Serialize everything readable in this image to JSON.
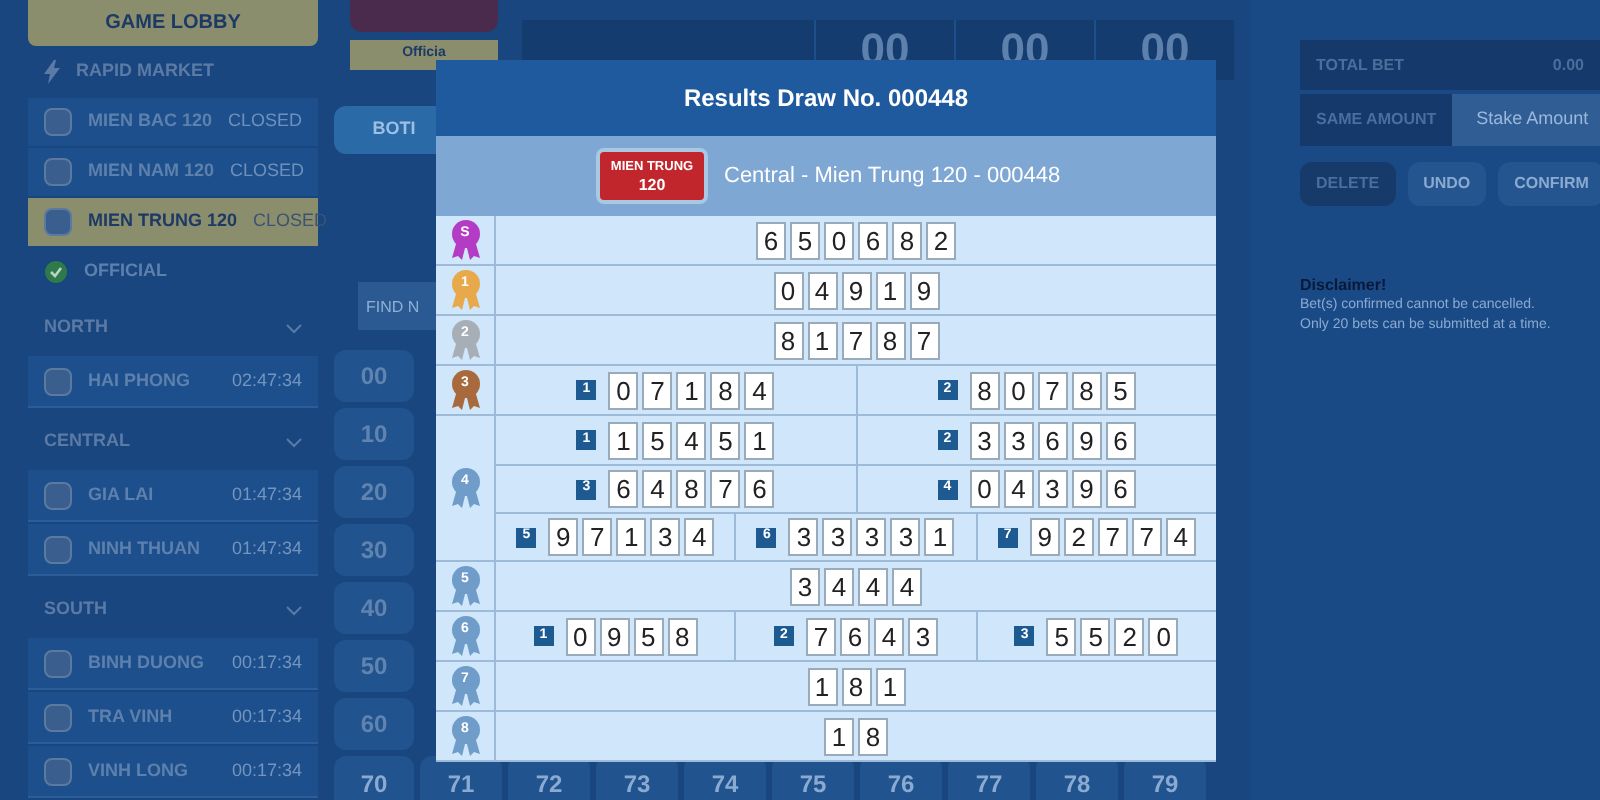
{
  "sidebar": {
    "lobby_button": "GAME LOBBY",
    "rapid_market": "RAPID MARKET",
    "markets": [
      {
        "name": "MIEN BAC 120",
        "status": "CLOSED",
        "selected": false
      },
      {
        "name": "MIEN NAM 120",
        "status": "CLOSED",
        "selected": false
      },
      {
        "name": "MIEN TRUNG 120",
        "status": "CLOSED",
        "selected": true
      }
    ],
    "official": "OFFICIAL",
    "regions": [
      {
        "name": "NORTH",
        "expanded": true,
        "items": [
          {
            "name": "HAI PHONG",
            "time": "02:47:34"
          }
        ]
      },
      {
        "name": "CENTRAL",
        "expanded": true,
        "items": [
          {
            "name": "GIA LAI",
            "time": "01:47:34"
          },
          {
            "name": "NINH THUAN",
            "time": "01:47:34"
          }
        ]
      },
      {
        "name": "SOUTH",
        "expanded": true,
        "items": [
          {
            "name": "BINH DUONG",
            "time": "00:17:34"
          },
          {
            "name": "TRA VINH",
            "time": "00:17:34"
          },
          {
            "name": "VINH LONG",
            "time": "00:17:34"
          }
        ]
      }
    ]
  },
  "game": {
    "official_label": "Officia",
    "timer": [
      "00",
      "00",
      "00"
    ],
    "mode_button": "BOTI",
    "find_placeholder": "FIND N",
    "number_column": [
      "00",
      "10",
      "20",
      "30",
      "40",
      "50",
      "60"
    ],
    "last_row": [
      "70",
      "71",
      "72",
      "73",
      "74",
      "75",
      "76",
      "77",
      "78",
      "79"
    ]
  },
  "bet_panel": {
    "total_bet_label": "TOTAL BET",
    "total_bet": "0.00",
    "same_amount_label": "SAME AMOUNT",
    "stake_placeholder": "Stake Amount",
    "buttons": [
      "DELETE",
      "UNDO",
      "CONFIRM"
    ],
    "disclaimer_title": "Disclaimer!",
    "disclaimer_lines": [
      "Bet(s) confirmed cannot be cancelled.",
      "Only 20 bets can be submitted at a time."
    ]
  },
  "results_modal": {
    "title": "Results Draw No. 000448",
    "badge": [
      "MIEN TRUNG",
      "120"
    ],
    "subtitle": "Central - Mien Trung 120 - 000448",
    "prizes": [
      {
        "label": "S",
        "color": "#b43cc4",
        "rows": [
          [
            {
              "digits": [
                "6",
                "5",
                "0",
                "6",
                "8",
                "2"
              ]
            }
          ]
        ]
      },
      {
        "label": "1",
        "color": "#e8a94a",
        "rows": [
          [
            {
              "digits": [
                "0",
                "4",
                "9",
                "1",
                "9"
              ]
            }
          ]
        ]
      },
      {
        "label": "2",
        "color": "#a8aeb6",
        "rows": [
          [
            {
              "digits": [
                "8",
                "1",
                "7",
                "8",
                "7"
              ]
            }
          ]
        ]
      },
      {
        "label": "3",
        "color": "#a86a3c",
        "rows": [
          [
            {
              "index": "1",
              "digits": [
                "0",
                "7",
                "1",
                "8",
                "4"
              ]
            },
            {
              "index": "2",
              "digits": [
                "8",
                "0",
                "7",
                "8",
                "5"
              ]
            }
          ]
        ]
      },
      {
        "label": "4",
        "color": "#6f9cc8",
        "rows": [
          [
            {
              "index": "1",
              "digits": [
                "1",
                "5",
                "4",
                "5",
                "1"
              ]
            },
            {
              "index": "2",
              "digits": [
                "3",
                "3",
                "6",
                "9",
                "6"
              ]
            }
          ],
          [
            {
              "index": "3",
              "digits": [
                "6",
                "4",
                "8",
                "7",
                "6"
              ]
            },
            {
              "index": "4",
              "digits": [
                "0",
                "4",
                "3",
                "9",
                "6"
              ]
            }
          ],
          [
            {
              "index": "5",
              "digits": [
                "9",
                "7",
                "1",
                "3",
                "4"
              ]
            },
            {
              "index": "6",
              "digits": [
                "3",
                "3",
                "3",
                "3",
                "1"
              ]
            },
            {
              "index": "7",
              "digits": [
                "9",
                "2",
                "7",
                "7",
                "4"
              ]
            }
          ]
        ]
      },
      {
        "label": "5",
        "color": "#6f9cc8",
        "rows": [
          [
            {
              "digits": [
                "3",
                "4",
                "4",
                "4"
              ]
            }
          ]
        ]
      },
      {
        "label": "6",
        "color": "#6f9cc8",
        "rows": [
          [
            {
              "index": "1",
              "digits": [
                "0",
                "9",
                "5",
                "8"
              ]
            },
            {
              "index": "2",
              "digits": [
                "7",
                "6",
                "4",
                "3"
              ]
            },
            {
              "index": "3",
              "digits": [
                "5",
                "5",
                "2",
                "0"
              ]
            }
          ]
        ]
      },
      {
        "label": "7",
        "color": "#6f9cc8",
        "rows": [
          [
            {
              "digits": [
                "1",
                "8",
                "1"
              ]
            }
          ]
        ]
      },
      {
        "label": "8",
        "color": "#6f9cc8",
        "rows": [
          [
            {
              "digits": [
                "1",
                "8"
              ]
            }
          ]
        ]
      }
    ]
  }
}
